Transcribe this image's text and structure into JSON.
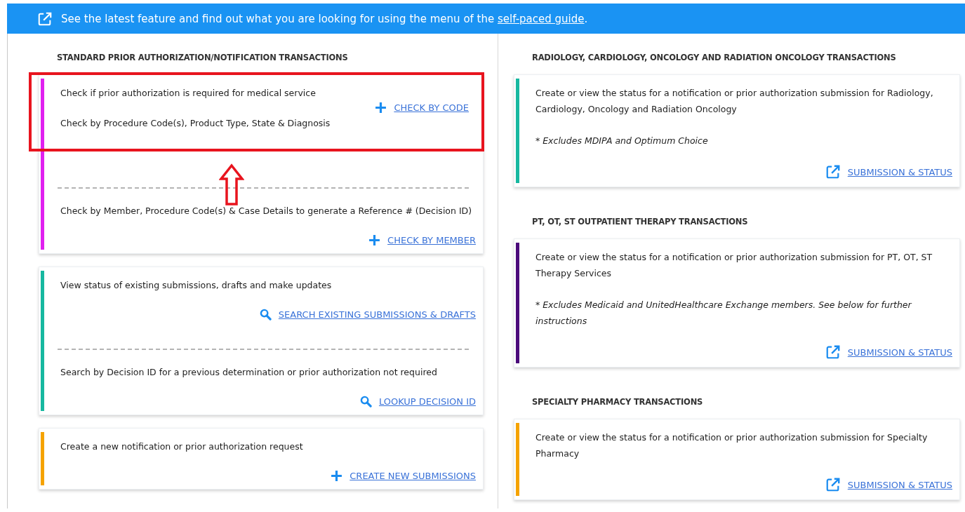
{
  "banner": {
    "text": "See the latest feature and find out what you are looking for using the menu of the",
    "link": "self-paced guide",
    "end": "."
  },
  "columns": [
    {
      "sections": [
        {
          "heading": "STANDARD PRIOR AUTHORIZATION/NOTIFICATION TRANSACTIONS",
          "cards": [
            {
              "color": "#e020f0",
              "blocks": [
                {
                  "kind": "side",
                  "highlighted": true,
                  "paragraphs": [
                    "Check if prior authorization is required for medical service",
                    "Check by Procedure Code(s), Product Type, State & Diagnosis"
                  ],
                  "action": {
                    "kind": "plus",
                    "label": "CHECK BY CODE"
                  }
                },
                {
                  "kind": "below",
                  "paragraphs": [
                    "Check by Member, Procedure Code(s) & Case Details to generate a Reference # (Decision ID)"
                  ],
                  "action": {
                    "kind": "plus",
                    "label": "CHECK BY MEMBER"
                  }
                }
              ]
            },
            {
              "color": "#17b8a0",
              "blocks": [
                {
                  "kind": "below",
                  "paragraphs": [
                    "View status of existing submissions, drafts and make updates"
                  ],
                  "action": {
                    "kind": "search",
                    "label": "SEARCH EXISTING SUBMISSIONS & DRAFTS"
                  }
                },
                {
                  "kind": "below",
                  "paragraphs": [
                    "Search by Decision ID for a previous determination or prior authorization not required"
                  ],
                  "action": {
                    "kind": "search",
                    "label": "LOOKUP DECISION ID"
                  }
                }
              ]
            },
            {
              "color": "#f5a300",
              "blocks": [
                {
                  "kind": "below",
                  "paragraphs": [
                    "Create a new notification or prior authorization request"
                  ],
                  "action": {
                    "kind": "plus",
                    "label": "CREATE NEW SUBMISSIONS"
                  }
                }
              ]
            }
          ]
        }
      ]
    },
    {
      "sections": [
        {
          "heading": "RADIOLOGY, CARDIOLOGY, ONCOLOGY AND RADIATION ONCOLOGY TRANSACTIONS",
          "cards": [
            {
              "color": "#17b8a0",
              "blocks": [
                {
                  "kind": "below",
                  "paragraphs": [
                    "Create or view the status for a notification or prior authorization submission for Radiology, Cardiology, Oncology and Radiation Oncology"
                  ],
                  "note": "* Excludes MDIPA and Optimum Choice",
                  "action": {
                    "kind": "external",
                    "label": "SUBMISSION & STATUS"
                  }
                }
              ]
            }
          ]
        },
        {
          "heading": "PT, OT, ST OUTPATIENT THERAPY TRANSACTIONS",
          "cards": [
            {
              "color": "#4b0a7a",
              "blocks": [
                {
                  "kind": "below",
                  "paragraphs": [
                    "Create or view the status for a notification or prior authorization submission for PT, OT, ST Therapy Services"
                  ],
                  "note": "* Excludes Medicaid and UnitedHealthcare Exchange members. See below for further instructions",
                  "action": {
                    "kind": "external",
                    "label": "SUBMISSION & STATUS"
                  }
                }
              ]
            }
          ]
        },
        {
          "heading": "SPECIALTY PHARMACY TRANSACTIONS",
          "cards": [
            {
              "color": "#f5a300",
              "blocks": [
                {
                  "kind": "below",
                  "paragraphs": [
                    "Create or view the status for a notification or prior authorization submission for Specialty Pharmacy"
                  ],
                  "action": {
                    "kind": "external",
                    "label": "SUBMISSION & STATUS"
                  }
                }
              ]
            }
          ]
        }
      ]
    }
  ]
}
